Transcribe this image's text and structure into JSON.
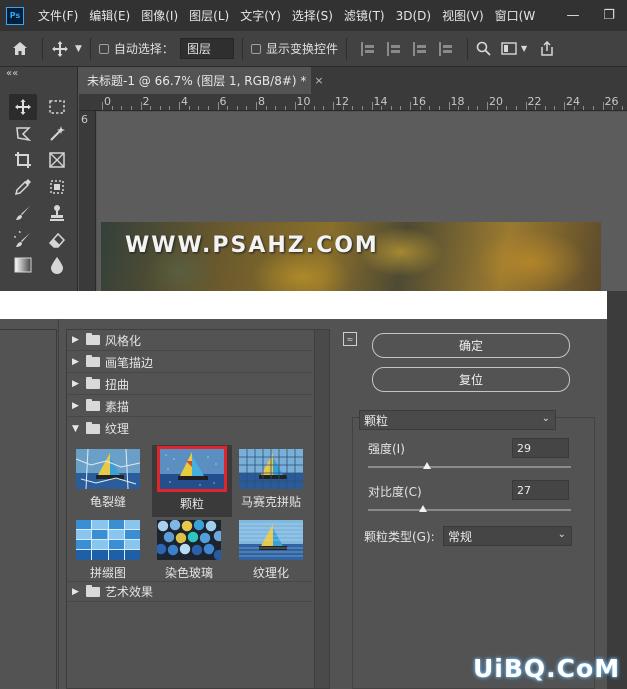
{
  "app": {
    "logo": "Ps"
  },
  "menubar": {
    "items": [
      "文件(F)",
      "编辑(E)",
      "图像(I)",
      "图层(L)",
      "文字(Y)",
      "选择(S)",
      "滤镜(T)",
      "3D(D)",
      "视图(V)",
      "窗口(W"
    ],
    "window_controls": [
      "—",
      "❐"
    ]
  },
  "options_bar": {
    "home_icon": "home-icon",
    "move_icon": "move-icon",
    "auto_select_label": "自动选择：",
    "auto_select_target": "图层",
    "show_transform_label": "显示变换控件"
  },
  "toolbar": {
    "collapse": "««",
    "tools": [
      "move",
      "marquee",
      "lasso",
      "magic-wand",
      "crop",
      "frame",
      "eyedropper",
      "spot-heal",
      "brush",
      "stamp",
      "history-brush",
      "eraser",
      "gradient",
      "blur"
    ]
  },
  "document": {
    "tab_title": "未标题-1 @ 66.7% (图层 1, RGB/8#) *",
    "close": "×",
    "ruler_top": [
      "0",
      "2",
      "4",
      "6",
      "8",
      "10",
      "12",
      "14",
      "16",
      "18",
      "20",
      "22",
      "24",
      "26"
    ],
    "ruler_left": "6",
    "watermark": "WWW.PSAHZ.COM"
  },
  "filter_gallery": {
    "categories": [
      {
        "label": "风格化",
        "expanded": false
      },
      {
        "label": "画笔描边",
        "expanded": false
      },
      {
        "label": "扭曲",
        "expanded": false
      },
      {
        "label": "素描",
        "expanded": false
      },
      {
        "label": "纹理",
        "expanded": true
      }
    ],
    "texture_filters": [
      {
        "label": "龟裂缝",
        "selected": false
      },
      {
        "label": "颗粒",
        "selected": true
      },
      {
        "label": "马赛克拼贴",
        "selected": false
      },
      {
        "label": "拼缀图",
        "selected": false
      },
      {
        "label": "染色玻璃",
        "selected": false
      },
      {
        "label": "纹理化",
        "selected": false
      }
    ],
    "last_category": {
      "label": "艺术效果",
      "expanded": false
    },
    "ok_button": "确定",
    "reset_button": "复位",
    "collapse_icon": "≈",
    "selected_filter": "颗粒",
    "params": {
      "intensity": {
        "label": "强度(I)",
        "value": "29",
        "fraction": 0.29
      },
      "contrast": {
        "label": "对比度(C)",
        "value": "27",
        "fraction": 0.27
      },
      "grain_type": {
        "label": "颗粒类型(G):",
        "value": "常规"
      }
    }
  },
  "site_mark": "UiBQ.CoM"
}
